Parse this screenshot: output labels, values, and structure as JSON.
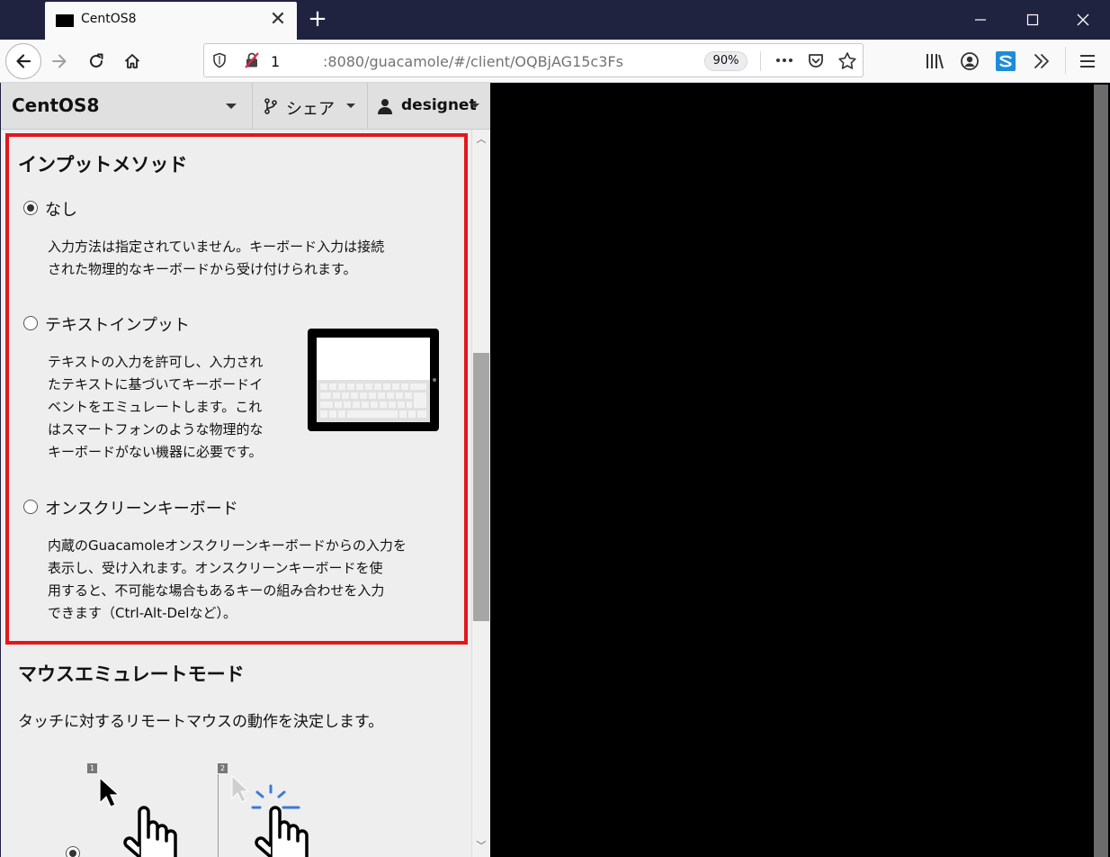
{
  "browser": {
    "tab_title": "CentOS8",
    "tab_close_glyph": "✕",
    "new_tab_glyph": "+",
    "window_controls": {
      "minimize": "—",
      "maximize": "☐",
      "close": "✕"
    },
    "url_host": "1",
    "url_path": ":8080/guacamole/#/client/OQBjAG15c3Fs",
    "zoom": "90%"
  },
  "guac_menu": {
    "connection_name": "CentOS8",
    "share_label": "シェア",
    "user_label": "designet"
  },
  "input_method": {
    "heading": "インプットメソッド",
    "options": [
      {
        "label": "なし",
        "selected": true,
        "desc": "入力方法は指定されていません。キーボード入力は接続\nされた物理的なキーボードから受け付けられます。"
      },
      {
        "label": "テキストインプット",
        "selected": false,
        "desc": "テキストの入力を許可し、入力され\nたテキストに基づいてキーボードイ\nベントをエミュレートします。これ\nはスマートフォンのような物理的な\nキーボードがない機器に必要です。"
      },
      {
        "label": "オンスクリーンキーボード",
        "selected": false,
        "desc": "内蔵のGuacamoleオンスクリーンキーボードからの入力を\n表示し、受け入れます。オンスクリーンキーボードを使\n用すると、不可能な場合もあるキーの組み合わせを入力\nできます（Ctrl-Alt-Delなど）。"
      }
    ]
  },
  "mouse_mode": {
    "heading": "マウスエミュレートモード",
    "desc": "タッチに対するリモートマウスの動作を決定します。",
    "step1": "1",
    "step2": "2"
  },
  "colors": {
    "highlight": "#e1171e",
    "titlebar": "#202340",
    "panel": "#eeeeee",
    "click_effect": "#3a7bd5"
  }
}
